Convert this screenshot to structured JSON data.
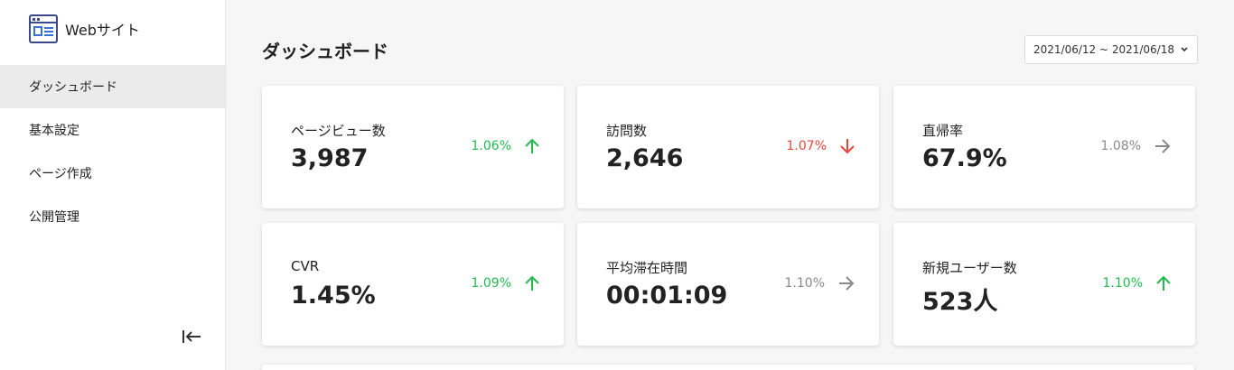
{
  "site": {
    "name": "Webサイト"
  },
  "nav": [
    {
      "label": "ダッシュボード",
      "active": true
    },
    {
      "label": "基本設定"
    },
    {
      "label": "ページ作成"
    },
    {
      "label": "公開管理"
    }
  ],
  "page": {
    "title": "ダッシュボード",
    "date_range": "2021/06/12 ~ 2021/06/18"
  },
  "metrics": [
    {
      "label": "ページビュー数",
      "value": "3,987",
      "change": "1.06%",
      "trend": "up"
    },
    {
      "label": "訪問数",
      "value": "2,646",
      "change": "1.07%",
      "trend": "down"
    },
    {
      "label": "直帰率",
      "value": "67.9%",
      "change": "1.08%",
      "trend": "flat"
    },
    {
      "label": "CVR",
      "value": "1.45%",
      "change": "1.09%",
      "trend": "up"
    },
    {
      "label": "平均滞在時間",
      "value": "00:01:09",
      "change": "1.10%",
      "trend": "flat"
    },
    {
      "label": "新規ユーザー数",
      "value": "523人",
      "change": "1.10%",
      "trend": "up"
    }
  ],
  "colors": {
    "up": "#22bb4e",
    "down": "#e8463a",
    "flat": "#8a8a8a",
    "brand_icon": "#3a4a8c",
    "active_nav_bg": "#ebebeb"
  },
  "icons": {
    "brand": "website-window-icon",
    "collapse": "collapse-sidebar-icon",
    "date_dropdown": "chevron-down-icon",
    "up": "arrow-up-icon",
    "down": "arrow-down-icon",
    "flat": "arrow-right-icon"
  }
}
